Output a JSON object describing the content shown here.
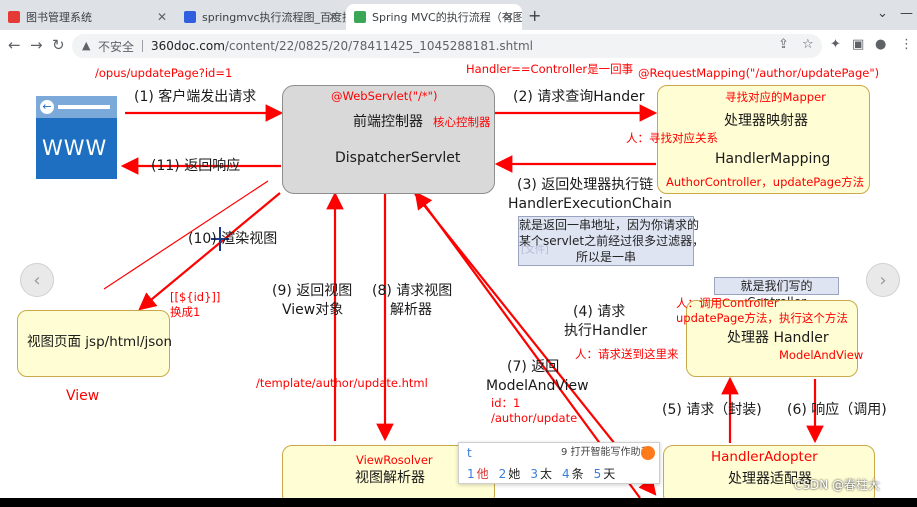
{
  "tabs": [
    {
      "label": "图书管理系统",
      "active": false
    },
    {
      "label": "springmvc执行流程图_百度搜索",
      "active": false
    },
    {
      "label": "Spring MVC的执行流程（有图有…",
      "active": true
    }
  ],
  "address": {
    "security": "不安全",
    "domain": "360doc.com",
    "path": "/content/22/0825/20/78411425_1045288181.shtml"
  },
  "diagram": {
    "url_top": "/opus/updatePage?id=1",
    "www": "WWW",
    "step1": "(1) 客户端发出请求",
    "step11": "(11) 返回响应",
    "handler_eq": "Handler==Controller是一回事",
    "request_mapping": "@RequestMapping(\"/author/updatePage\")",
    "webservlet": "@WebServlet(\"/*\")",
    "front_ctrl": "前端控制器",
    "core_ctrl": "核心控制器",
    "dispatcher": "DispatcherServlet",
    "step2": "(2) 请求查询Hander",
    "find_mapper": "寻找对应的Mapper",
    "handler_mapper_cn": "处理器映射器",
    "person_find": "人：寻找对应关系",
    "handler_mapping": "HandlerMapping",
    "author_ctrl": "AuthorController，updatePage方法",
    "step3a": "(3) 返回处理器执行链",
    "step3b": "HandlerExecutionChain",
    "note_chain": "就是返回一串地址，因为你请求的\n某个servlet之前经过很多过滤器，\n所以是一串",
    "step10": "(10) 渲染视图",
    "id_expr": "[[${id}]]",
    "replaced": "换成1",
    "view_page": "视图页面 jsp/html/json",
    "view": "View",
    "step9a": "(9) 返回视图",
    "step9b": "View对象",
    "step8a": "(8) 请求视图",
    "step8b": "解析器",
    "template_path": "/template/author/update.html",
    "step4a": "(4) 请求",
    "step4b": "执行Handler",
    "person_req": "人：请求送到这里来",
    "our_controller": "就是我们写的Controller",
    "person_call": "人：调用Controller",
    "update_exec": "updatePage方法，执行这个方法",
    "handler_cn": "处理器 Handler",
    "model_and_view_red": "ModelAndView",
    "step7a": "(7) 返回",
    "step7b": "ModelAndView",
    "id_value": "id：1",
    "author_update": "/author/update",
    "step5": "(5) 请求（封装)",
    "step6": "(6) 响应（调用)",
    "view_resolver_red": "ViewRosolver",
    "view_resolver_cn": "视图解析器",
    "handler_adopter": "HandlerAdopter",
    "handler_adapter_cn": "处理器适配器",
    "faded": "[文件]"
  },
  "ime": {
    "input": "t",
    "hint": "9 打开智能写作助手",
    "candidates": [
      {
        "n": "1",
        "w": "他"
      },
      {
        "n": "2",
        "w": "她"
      },
      {
        "n": "3",
        "w": "太"
      },
      {
        "n": "4",
        "w": "条"
      },
      {
        "n": "5",
        "w": "天"
      }
    ]
  },
  "watermark": "CSDN @春柱大"
}
